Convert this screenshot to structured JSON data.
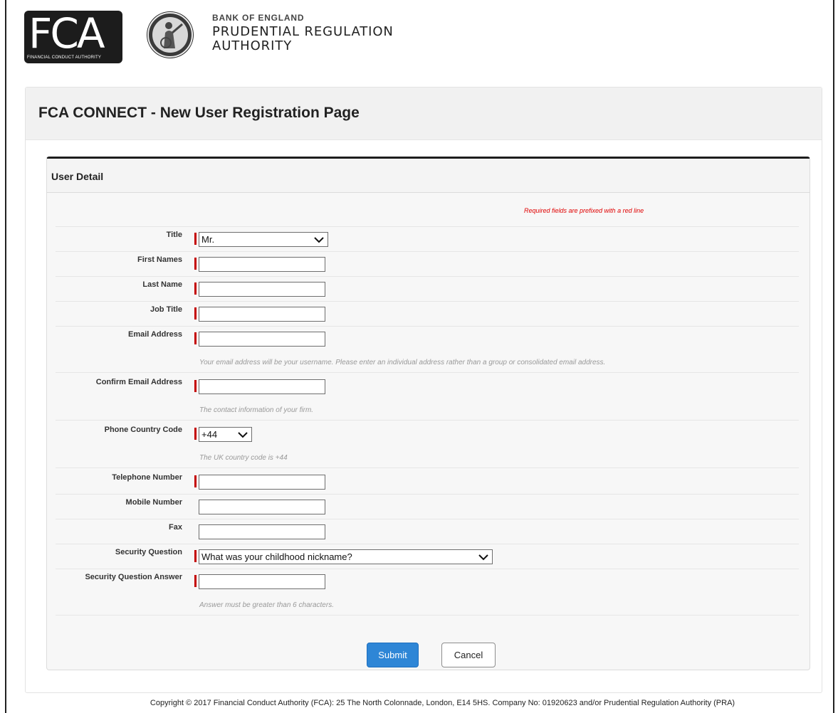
{
  "header": {
    "fca_logo_text": "FCA",
    "fca_logo_subtext": "FINANCIAL CONDUCT AUTHORITY",
    "pra_line1": "BANK OF ENGLAND",
    "pra_line2": "PRUDENTIAL REGULATION",
    "pra_line3": "AUTHORITY"
  },
  "page": {
    "title": "FCA CONNECT - New User Registration Page"
  },
  "panel": {
    "title": "User Detail",
    "required_note": "Required fields are prefixed with a red line"
  },
  "form": {
    "title": {
      "label": "Title",
      "value": "Mr."
    },
    "first_names": {
      "label": "First Names",
      "value": ""
    },
    "last_name": {
      "label": "Last Name",
      "value": ""
    },
    "job_title": {
      "label": "Job Title",
      "value": ""
    },
    "email": {
      "label": "Email Address",
      "value": "",
      "help": "Your email address will be your username. Please enter an individual address rather than a group or consolidated email address."
    },
    "confirm_email": {
      "label": "Confirm Email Address",
      "value": "",
      "help": "The contact information of your firm."
    },
    "phone_country_code": {
      "label": "Phone Country Code",
      "value": "+44",
      "help": "The UK country code is +44"
    },
    "telephone": {
      "label": "Telephone Number",
      "value": ""
    },
    "mobile": {
      "label": "Mobile Number",
      "value": ""
    },
    "fax": {
      "label": "Fax",
      "value": ""
    },
    "security_question": {
      "label": "Security Question",
      "value": "What was your childhood nickname?"
    },
    "security_answer": {
      "label": "Security Question Answer",
      "value": "",
      "help": "Answer must be greater than 6 characters."
    }
  },
  "buttons": {
    "submit": "Submit",
    "cancel": "Cancel"
  },
  "footer": {
    "copyright": "Copyright © 2017 Financial Conduct Authority (FCA): 25 The North Colonnade, London, E14 5HS. Company No: 01920623 and/or Prudential Regulation Authority (PRA)"
  },
  "colors": {
    "required_marker": "#c40000",
    "submit_button": "#2e86d6",
    "required_note": "#e00000"
  }
}
